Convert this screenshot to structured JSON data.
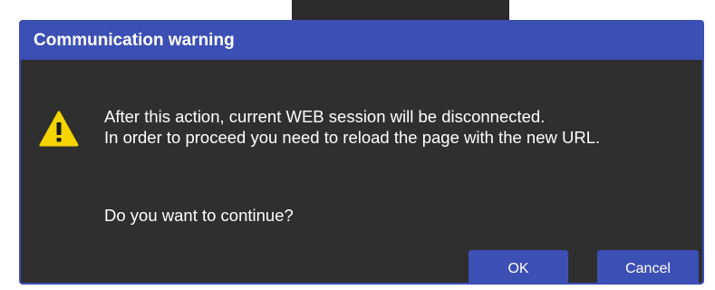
{
  "dialog": {
    "title": "Communication warning",
    "icon": "warning-icon",
    "message_line1": "After this action, current WEB session will be disconnected.",
    "message_line2": "In order to proceed you need to reload the page with the new URL.",
    "question": "Do you want to continue?",
    "ok_label": "OK",
    "cancel_label": "Cancel"
  },
  "colors": {
    "accent": "#3c4fb4",
    "dialog_bg": "#2f2f2f",
    "warning_yellow": "#f5d400"
  }
}
